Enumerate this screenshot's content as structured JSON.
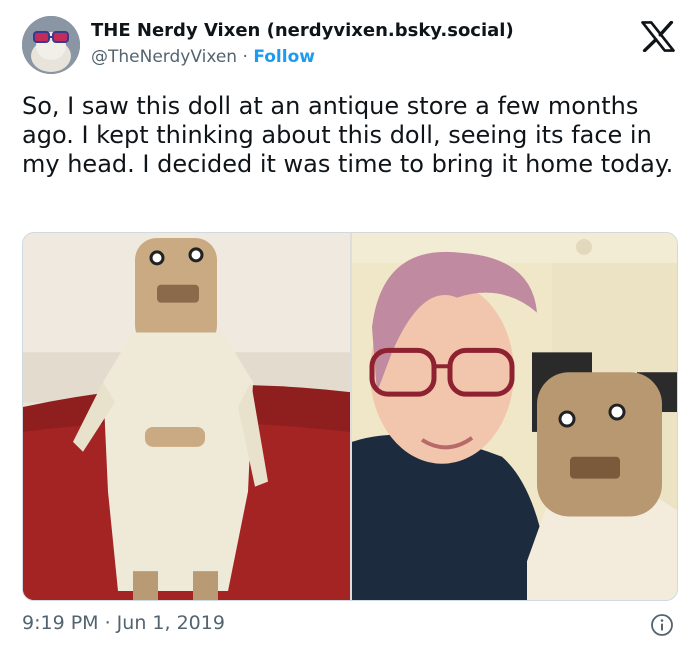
{
  "tweet": {
    "author_name": "THE Nerdy Vixen (nerdyvixen.bsky.social)",
    "handle": "@TheNerdyVixen",
    "separator": " · ",
    "follow_label": "Follow",
    "text": "So, I saw this doll at an antique store a few months ago. I kept thinking about this doll, seeing its face in my head. I decided it was time to bring it home today.",
    "timestamp": "9:19 PM · Jun 1, 2019"
  },
  "icons": {
    "logo": "x-logo-icon",
    "info": "info-icon"
  },
  "colors": {
    "accent": "#1d9bf0",
    "secondary_text": "#536471",
    "border": "#cfd9de"
  }
}
